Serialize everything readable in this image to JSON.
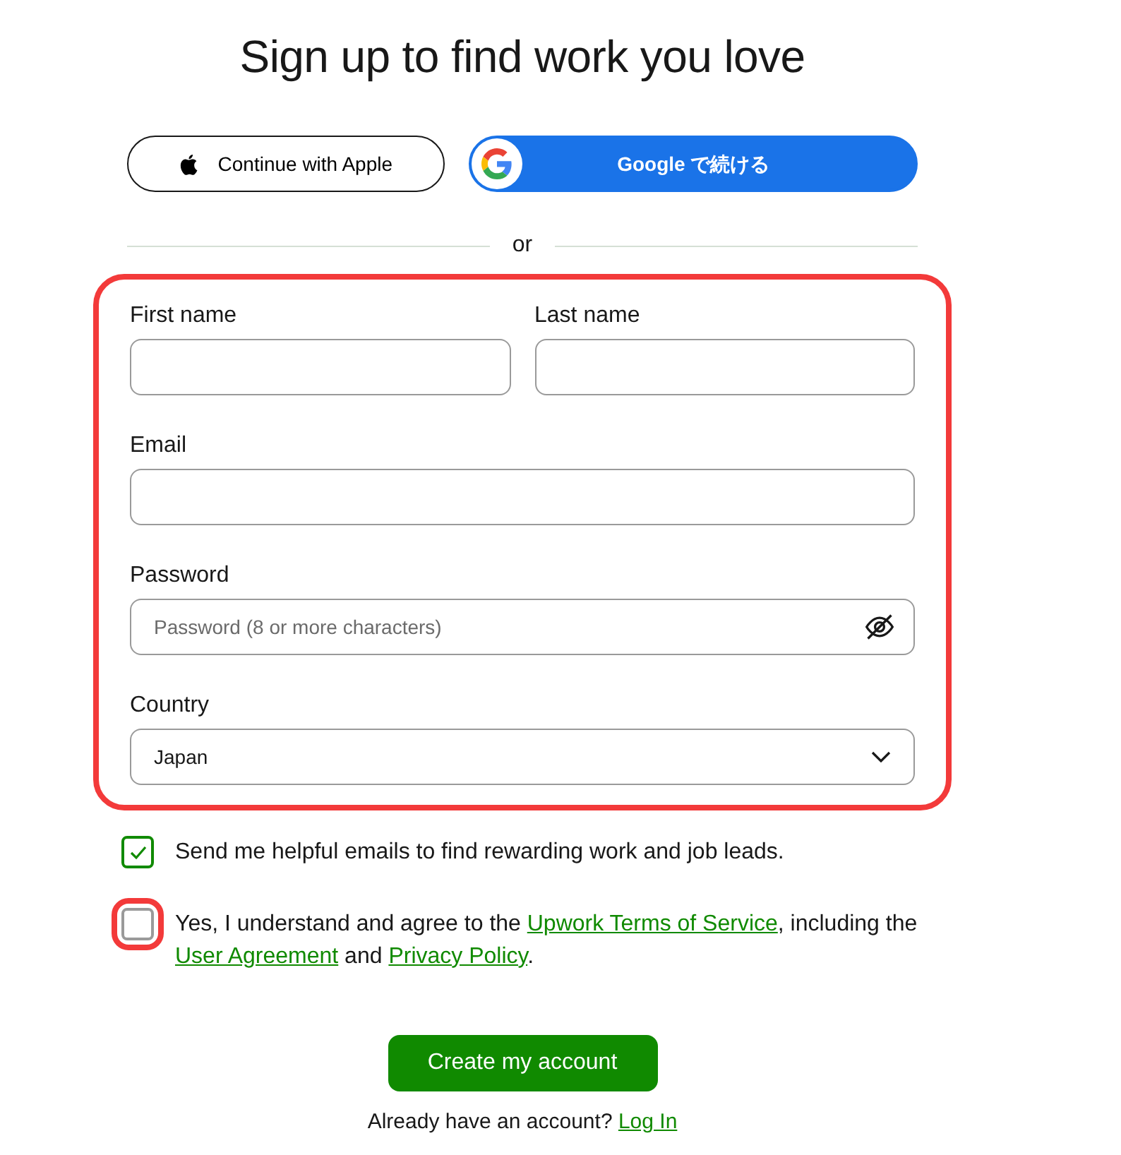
{
  "title": "Sign up to find work you love",
  "social_buttons": [
    {
      "kind": "apple",
      "label": "Continue with Apple"
    },
    {
      "kind": "google",
      "label": "Google で続ける"
    }
  ],
  "divider": "or",
  "form": {
    "highlighted": true,
    "fields": [
      {
        "label": "First name",
        "kind": "text"
      },
      {
        "label": "Last name",
        "kind": "text"
      },
      {
        "label": "Email",
        "kind": "text"
      },
      {
        "label": "Password",
        "kind": "password",
        "placeholder": "Password (8 or more characters)"
      },
      {
        "label": "Country",
        "kind": "select",
        "value": "Japan"
      }
    ]
  },
  "checkboxes": [
    {
      "checked": true,
      "highlighted": false,
      "segments": [
        {
          "kind": "text",
          "text": "Send me helpful emails to find rewarding work and job leads."
        }
      ]
    },
    {
      "checked": false,
      "highlighted": true,
      "segments": [
        {
          "kind": "text",
          "text": "Yes, I understand and agree to the "
        },
        {
          "kind": "link",
          "text": "Upwork Terms of Service"
        },
        {
          "kind": "text",
          "text": ", including the "
        },
        {
          "kind": "link",
          "text": "User Agreement"
        },
        {
          "kind": "text",
          "text": " and "
        },
        {
          "kind": "link",
          "text": "Privacy Policy"
        },
        {
          "kind": "text",
          "text": "."
        }
      ]
    }
  ],
  "submit": "Create my account",
  "login_prompt": {
    "text": "Already have an account?",
    "link": "Log In"
  }
}
